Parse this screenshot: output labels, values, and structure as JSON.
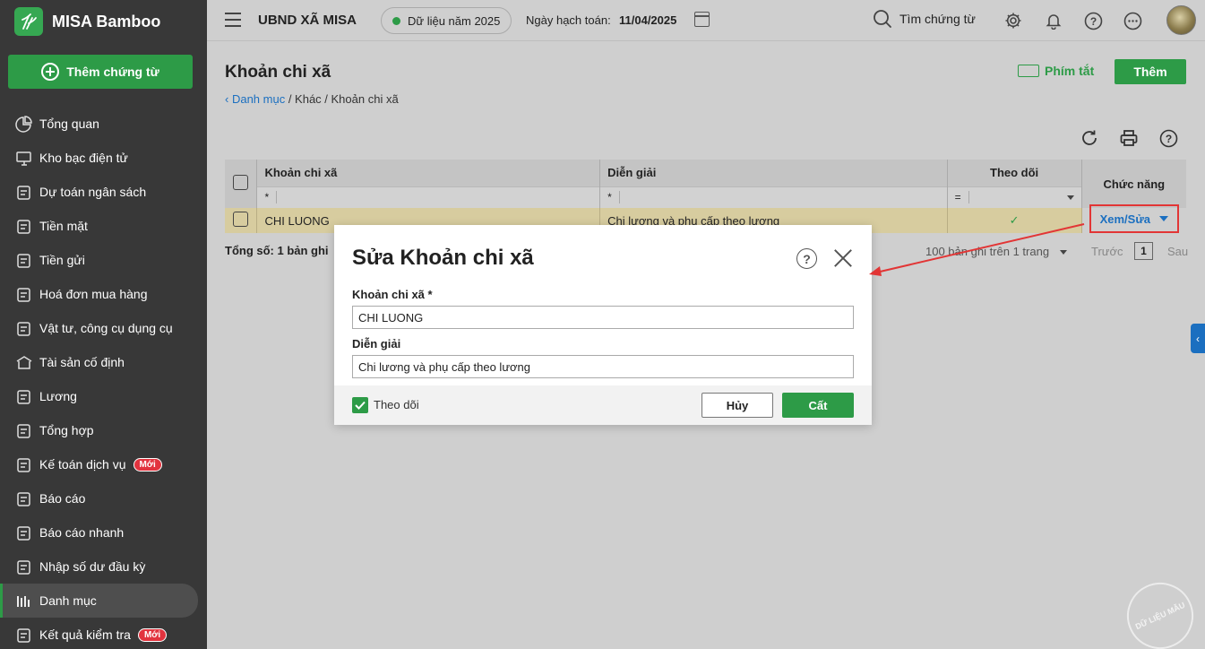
{
  "app": {
    "name": "MISA Bamboo",
    "add_voucher": "Thêm chứng từ"
  },
  "sidebar": {
    "items": [
      {
        "label": "Tổng quan",
        "icon": "pie-chart-icon"
      },
      {
        "label": "Kho bạc điện tử",
        "icon": "monitor-icon"
      },
      {
        "label": "Dự toán ngân sách",
        "icon": "budget-icon"
      },
      {
        "label": "Tiền mặt",
        "icon": "cash-icon"
      },
      {
        "label": "Tiền gửi",
        "icon": "deposit-icon"
      },
      {
        "label": "Hoá đơn mua hàng",
        "icon": "invoice-icon"
      },
      {
        "label": "Vật tư, công cụ dụng cụ",
        "icon": "tools-icon"
      },
      {
        "label": "Tài sản cố định",
        "icon": "building-icon"
      },
      {
        "label": "Lương",
        "icon": "salary-icon"
      },
      {
        "label": "Tổng hợp",
        "icon": "summary-icon"
      },
      {
        "label": "Kế toán dịch vụ",
        "icon": "service-icon",
        "badge": "Mới"
      },
      {
        "label": "Báo cáo",
        "icon": "report-icon"
      },
      {
        "label": "Báo cáo nhanh",
        "icon": "quick-report-icon"
      },
      {
        "label": "Nhập số dư đầu kỳ",
        "icon": "opening-balance-icon"
      },
      {
        "label": "Danh mục",
        "icon": "catalog-icon",
        "active": true
      },
      {
        "label": "Kết quả kiểm tra",
        "icon": "check-result-icon",
        "badge": "Mới"
      }
    ]
  },
  "topbar": {
    "org": "UBND XÃ MISA",
    "year": "Dữ liệu năm 2025",
    "date_label": "Ngày hạch toán:",
    "date_value": "11/04/2025",
    "search": "Tìm chứng từ"
  },
  "page": {
    "title": "Khoản chi xã",
    "shortcut": "Phím tắt",
    "add": "Thêm",
    "breadcrumb": {
      "link": "Danh mục",
      "rest": " / Khác / Khoản chi xã"
    }
  },
  "table": {
    "columns": {
      "code": "Khoản chi xã",
      "desc": "Diễn giải",
      "track": "Theo dõi",
      "func": "Chức năng"
    },
    "filters": {
      "code": "*",
      "desc": "*",
      "track": "="
    },
    "rows": [
      {
        "code": "CHI LUONG",
        "desc": "Chi lương và phụ cấp theo lương",
        "track": "✓",
        "action": "Xem/Sửa"
      }
    ],
    "total": "Tổng số: 1 bản ghi",
    "pager": {
      "per_page": "100 bản ghi trên 1 trang",
      "prev": "Trước",
      "page": "1",
      "next": "Sau"
    }
  },
  "dialog": {
    "title": "Sửa Khoản chi xã",
    "code_label": "Khoản chi xã *",
    "code_value": "CHI LUONG",
    "desc_label": "Diễn giải",
    "desc_value": "Chi lương và phụ cấp theo lương",
    "track_label": "Theo dõi",
    "cancel": "Hủy",
    "save": "Cất"
  },
  "watermark": "DỮ LIỆU MẪU",
  "colors": {
    "primary": "#2d9b47",
    "link": "#1b6fc0",
    "highlight": "#e23535",
    "sidebar": "#383838"
  }
}
